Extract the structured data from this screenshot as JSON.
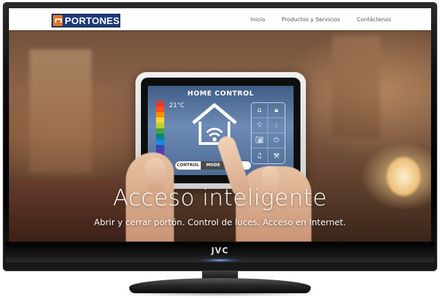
{
  "tv": {
    "brand": "JVC"
  },
  "site": {
    "logo_text": "PORTONES",
    "logo_colors": {
      "background": "#1c3a7a",
      "mark": "#e67822"
    },
    "nav": [
      {
        "label": "Inicio"
      },
      {
        "label": "Productos y Servicios"
      },
      {
        "label": "Contáctenos"
      }
    ]
  },
  "tablet": {
    "title": "HOME CONTROL",
    "temperature": "21°C",
    "scale_colors": [
      "#e53935",
      "#f4511e",
      "#fb8c00",
      "#fdd835",
      "#c0ca33",
      "#43a047",
      "#00897b",
      "#1e88e5",
      "#3949ab",
      "#5e35b1"
    ],
    "icons": [
      "home-icon",
      "lock-icon",
      "bulb-icon",
      "water-drop-icon",
      "camera-icon",
      "power-icon",
      "music-icon",
      "tools-icon"
    ],
    "icon_glyphs": [
      "⌂",
      "🔒︎",
      "💡︎",
      "💧︎",
      "📷︎",
      "⏻",
      "♫",
      "⚒"
    ],
    "modes": [
      {
        "label": "CONTROL",
        "active": false
      },
      {
        "label": "MODE",
        "active": true
      },
      {
        "label": "",
        "active": false
      }
    ]
  },
  "hero": {
    "title": "Acceso inteligente",
    "subtitle": "Abrir y cerrar portón. Control de luces. Acceso en Internet."
  }
}
